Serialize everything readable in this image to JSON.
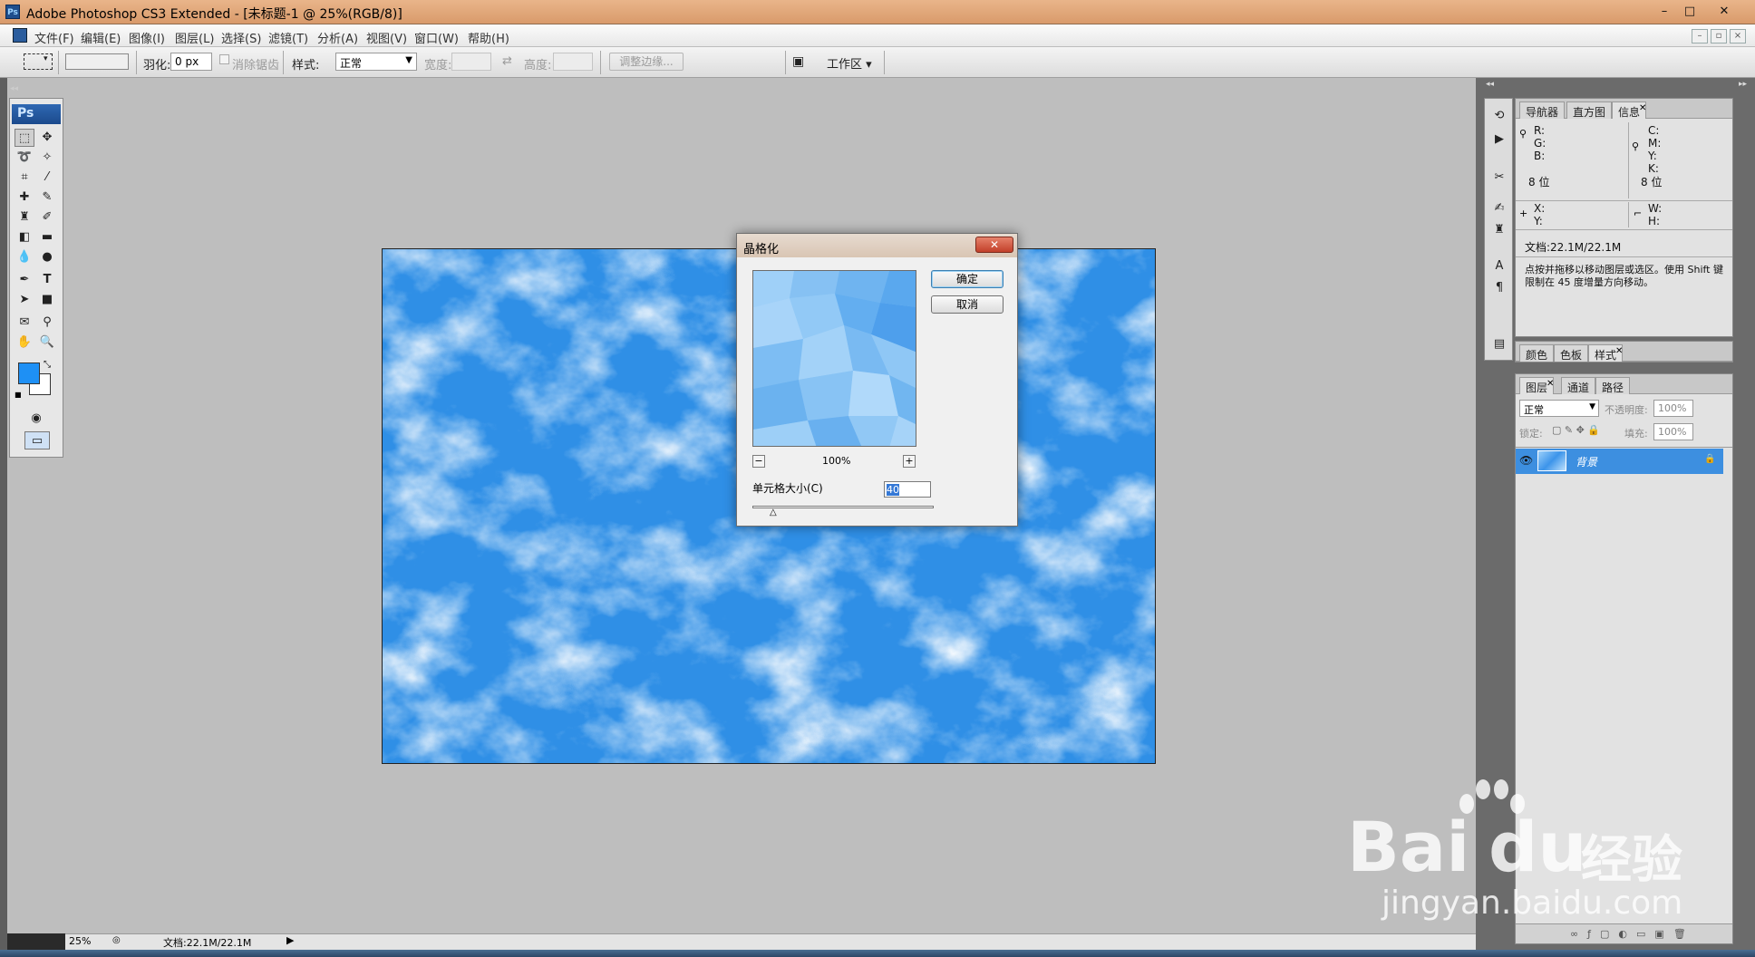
{
  "window": {
    "title": "Adobe Photoshop CS3 Extended - [未标题-1 @ 25%(RGB/8)]",
    "app_icon_text": "Ps",
    "minimize": "–",
    "maximize": "□",
    "close": "✕"
  },
  "menubar": {
    "items": [
      "文件(F)",
      "编辑(E)",
      "图像(I)",
      "图层(L)",
      "选择(S)",
      "滤镜(T)",
      "分析(A)",
      "视图(V)",
      "窗口(W)",
      "帮助(H)"
    ]
  },
  "options": {
    "feather_label": "羽化:",
    "feather_value": "0 px",
    "antialias_label": "消除锯齿",
    "style_label": "样式:",
    "style_value": "正常",
    "width_label": "宽度:",
    "height_label": "高度:",
    "refine_edge": "调整边缘...",
    "workspace": "工作区 ▾"
  },
  "toolbox": {
    "logo": "Ps",
    "foreground_color": "#1e90f5",
    "background_color": "#ffffff"
  },
  "dialog": {
    "title": "晶格化",
    "close": "✕",
    "ok": "确定",
    "cancel": "取消",
    "zoom_minus": "−",
    "zoom_plus": "+",
    "zoom_value": "100%",
    "cell_size_label": "单元格大小(C)",
    "cell_size_value": "40"
  },
  "info_panel": {
    "tabs": [
      "导航器",
      "直方图",
      "信息"
    ],
    "r": "R:",
    "g": "G:",
    "b": "B:",
    "c": "C:",
    "m": "M:",
    "y": "Y:",
    "k": "K:",
    "bits_left": "8 位",
    "bits_right": "8 位",
    "x": "X:",
    "y2": "Y:",
    "w": "W:",
    "h": "H:",
    "doc": "文档:22.1M/22.1M",
    "hint": "点按并拖移以移动图层或选区。使用 Shift 键限制在 45 度增量方向移动。"
  },
  "color_panel": {
    "tabs": [
      "颜色",
      "色板",
      "样式"
    ]
  },
  "layers_panel": {
    "tabs": [
      "图层",
      "通道",
      "路径"
    ],
    "blend_mode": "正常",
    "opacity_label": "不透明度:",
    "opacity_value": "100%",
    "lock_label": "锁定:",
    "fill_label": "填充:",
    "fill_value": "100%",
    "layer_name": "背景"
  },
  "statusbar": {
    "zoom": "25%",
    "doc": "文档:22.1M/22.1M"
  },
  "watermark": {
    "brand": "Bai",
    "brand_tail": "du",
    "cn": "经验",
    "url": "jingyan.baidu.com"
  }
}
